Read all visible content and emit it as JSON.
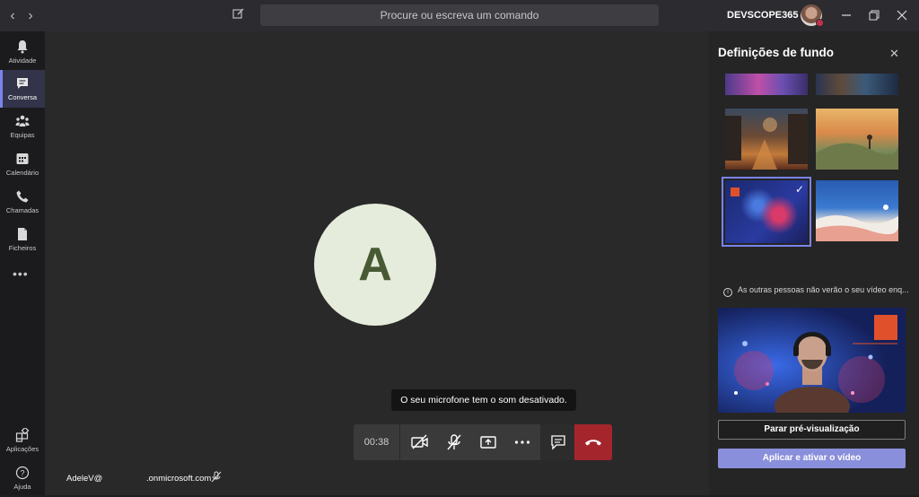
{
  "titlebar": {
    "search_placeholder": "Procure ou escreva um comando",
    "org_name": "DEVSCOPE365"
  },
  "rail": {
    "items": [
      {
        "label": "Atividade",
        "icon": "bell-icon"
      },
      {
        "label": "Conversa",
        "icon": "chat-icon",
        "active": true
      },
      {
        "label": "Equipas",
        "icon": "teams-icon"
      },
      {
        "label": "Calendário",
        "icon": "calendar-icon"
      },
      {
        "label": "Chamadas",
        "icon": "phone-icon"
      },
      {
        "label": "Ficheiros",
        "icon": "file-icon"
      }
    ],
    "more": "•••",
    "bottom": [
      {
        "label": "Aplicações",
        "icon": "apps-icon"
      },
      {
        "label": "Ajuda",
        "icon": "help-icon"
      }
    ]
  },
  "stage": {
    "avatar_initial": "A",
    "tooltip": "O seu microfone tem o som desativado.",
    "call_time": "00:38",
    "participant_name_left": "AdeleV@",
    "participant_name_right": ".onmicrosoft.com"
  },
  "panel": {
    "title": "Definições de fundo",
    "info_text": "As outras pessoas não verão o seu vídeo enq...",
    "stop_preview_label": "Parar pré-visualização",
    "apply_label": "Aplicar e ativar o vídeo",
    "accent_color": "#7b83eb"
  }
}
